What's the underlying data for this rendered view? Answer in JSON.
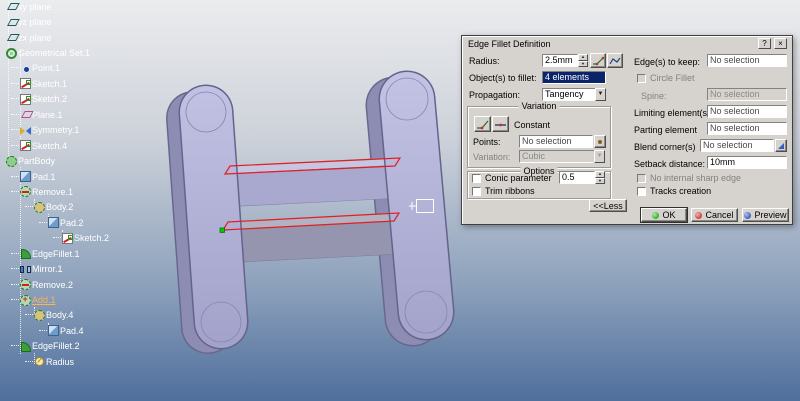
{
  "tree": {
    "items": [
      {
        "label": "xy plane",
        "level": 0,
        "icon": "plane"
      },
      {
        "label": "yz plane",
        "level": 0,
        "icon": "plane"
      },
      {
        "label": "zx plane",
        "level": 0,
        "icon": "plane"
      },
      {
        "label": "Geometrical Set.1",
        "level": 0,
        "icon": "geoset"
      },
      {
        "label": "Point.1",
        "level": 1,
        "icon": "point"
      },
      {
        "label": "Sketch.1",
        "level": 1,
        "icon": "sketch"
      },
      {
        "label": "Sketch.2",
        "level": 1,
        "icon": "sketch"
      },
      {
        "label": "Plane.1",
        "level": 1,
        "icon": "planefeat"
      },
      {
        "label": "Symmetry.1",
        "level": 1,
        "icon": "symmetry"
      },
      {
        "label": "Sketch.4",
        "level": 1,
        "icon": "sketch"
      },
      {
        "label": "PartBody",
        "level": 0,
        "icon": "partbody"
      },
      {
        "label": "Pad.1",
        "level": 1,
        "icon": "pad"
      },
      {
        "label": "Remove.1",
        "level": 1,
        "icon": "remove"
      },
      {
        "label": "Body.2",
        "level": 2,
        "icon": "body"
      },
      {
        "label": "Pad.2",
        "level": 3,
        "icon": "pad"
      },
      {
        "label": "Sketch.2",
        "level": 4,
        "icon": "sketch"
      },
      {
        "label": "EdgeFillet.1",
        "level": 1,
        "icon": "fillet"
      },
      {
        "label": "Mirror.1",
        "level": 1,
        "icon": "mirror"
      },
      {
        "label": "Remove.2",
        "level": 1,
        "icon": "remove"
      },
      {
        "label": "Add.1",
        "level": 1,
        "icon": "add",
        "highlight": true
      },
      {
        "label": "Body.4",
        "level": 2,
        "icon": "body"
      },
      {
        "label": "Pad.4",
        "level": 3,
        "icon": "pad"
      },
      {
        "label": "EdgeFillet.2",
        "level": 1,
        "icon": "fillet"
      },
      {
        "label": "Radius",
        "level": 2,
        "icon": "radius"
      }
    ]
  },
  "dialog": {
    "title": "Edge Fillet Definition",
    "help_button": "?",
    "close_button": "×",
    "radius_label": "Radius:",
    "radius_value": "2.5mm",
    "objects_label": "Object(s) to fillet:",
    "objects_value": "4 elements",
    "propagation_label": "Propagation:",
    "propagation_value": "Tangency",
    "variation_group_label": "Variation",
    "constant_mode_label": "Constant",
    "points_label": "Points:",
    "points_value": "No selection",
    "variation_label": "Variation:",
    "variation_value": "Cubic",
    "options_group_label": "Options",
    "conic_label": "Conic parameter",
    "conic_value": "0.5",
    "trim_label": "Trim ribbons",
    "edges_keep_label": "Edge(s) to keep:",
    "edges_keep_value": "No selection",
    "circle_fillet_label": "Circle Fillet",
    "spine_label": "Spine:",
    "spine_value": "No selection",
    "limiting_label": "Limiting element(s):",
    "limiting_value": "No selection",
    "parting_label": "Parting element",
    "parting_value": "No selection",
    "blend_label": "Blend corner(s)",
    "blend_value": "No selection",
    "setback_label": "Setback distance:",
    "setback_value": "10mm",
    "no_sharp_label": "No internal sharp edge",
    "tracks_label": "Tracks creation",
    "less_button": "<<Less",
    "ok_button": "OK",
    "cancel_button": "Cancel",
    "preview_button": "Preview"
  },
  "colors": {
    "part_face": "#b2b2d8",
    "part_side": "#8d8db4",
    "selected_edge": "#e02020",
    "selection_highlight": "#0a246a"
  }
}
